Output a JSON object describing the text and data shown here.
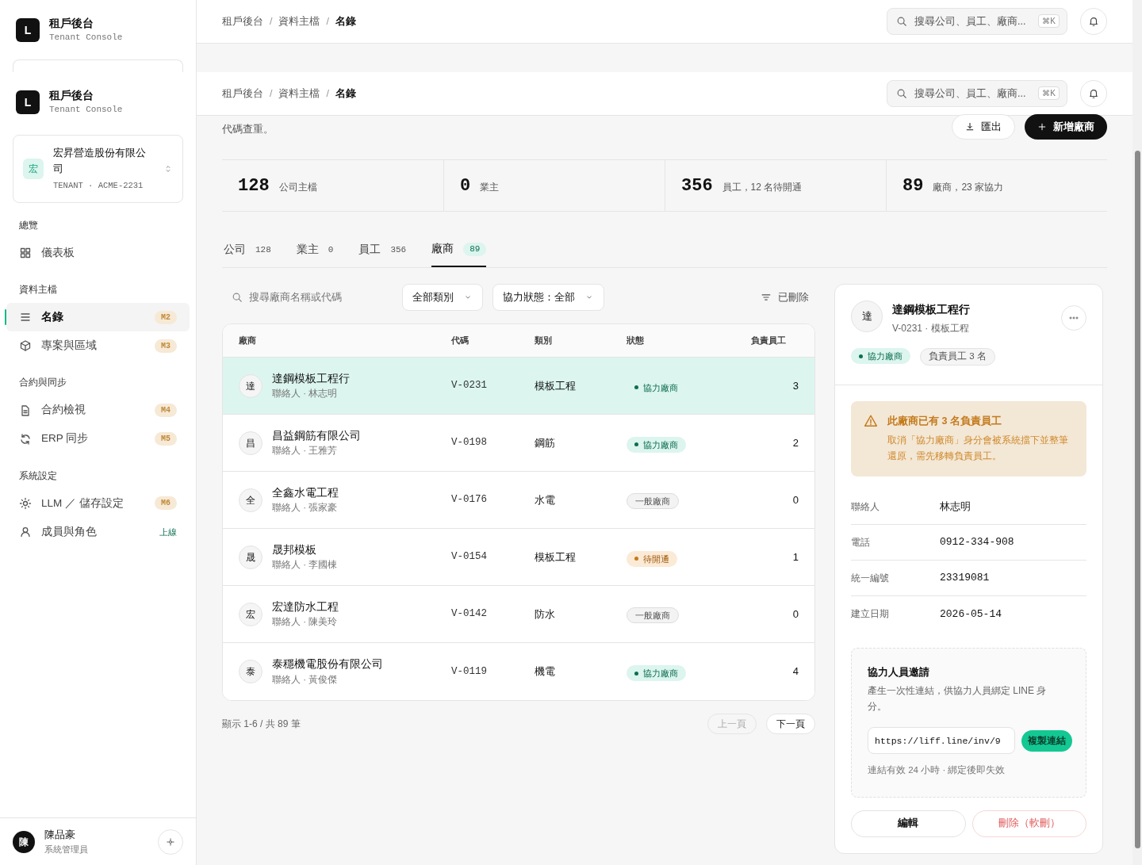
{
  "sidebar": {
    "brands": [
      {
        "logo": "L",
        "title": "租戶後台",
        "subtitle": "Tenant Console"
      },
      {
        "logo": "L",
        "title": "租戶後台",
        "subtitle": "Tenant Console"
      }
    ],
    "tenant": {
      "avatar": "宏",
      "name": "宏昇營造股份有限公司",
      "meta": "TENANT · ACME-2231"
    },
    "sections": [
      {
        "title": "總覽",
        "items": [
          {
            "label": "儀表板",
            "selected": false
          }
        ]
      },
      {
        "title": "資料主檔",
        "items": [
          {
            "label": "名錄",
            "selected": true,
            "badge": "M2",
            "kind": "milestone"
          },
          {
            "label": "專案與區域",
            "selected": false,
            "badge": "M3",
            "kind": "milestone"
          }
        ]
      },
      {
        "title": "合約與同步",
        "items": [
          {
            "label": "合約檢視",
            "selected": false,
            "badge": "M4",
            "kind": "milestone"
          },
          {
            "label": "ERP 同步",
            "selected": false,
            "badge": "M5",
            "kind": "milestone"
          }
        ]
      },
      {
        "title": "系統設定",
        "items": [
          {
            "label": "LLM ／ 儲存設定",
            "selected": false,
            "badge": "M6",
            "kind": "milestone"
          },
          {
            "label": "成員與角色",
            "selected": false,
            "badge": "上線",
            "kind": "live"
          }
        ]
      }
    ],
    "user": {
      "avatar": "陳",
      "name": "陳品豪",
      "role": "系統管理員"
    }
  },
  "headers": [
    {
      "breadcrumbs": [
        "租戶後台",
        "資料主檔",
        "名錄"
      ],
      "separator": "/",
      "search_placeholder": "搜尋公司、員工、廠商...",
      "shortcut": "⌘K"
    },
    {
      "breadcrumbs": [
        "租戶後台",
        "資料主檔",
        "名錄"
      ],
      "separator": "/",
      "search_placeholder": "搜尋公司、員工、廠商...",
      "shortcut": "⌘K"
    }
  ],
  "description": "代碼查重。",
  "actions": [
    {
      "label": "匯出",
      "kind": "secondary"
    },
    {
      "label": "新增廠商",
      "kind": "primary"
    }
  ],
  "stats": [
    {
      "value": "128",
      "label": "公司主檔"
    },
    {
      "value": "0",
      "label": "業主"
    },
    {
      "value": "356",
      "label": "員工，12 名待開通"
    },
    {
      "value": "89",
      "label": "廠商，23 家協力"
    }
  ],
  "tabs": [
    {
      "label": "公司",
      "count": "128",
      "selected": false
    },
    {
      "label": "業主",
      "count": "0",
      "selected": false
    },
    {
      "label": "員工",
      "count": "356",
      "selected": false
    },
    {
      "label": "廠商",
      "count": "89",
      "selected": true
    }
  ],
  "filters": {
    "search_placeholder": "搜尋廠商名稱或代碼",
    "dropdowns": [
      "全部類別",
      "協力狀態：全部"
    ],
    "deleted_toggle": "已刪除"
  },
  "table": {
    "columns": [
      "廠商",
      "代碼",
      "類別",
      "狀態",
      "負責員工"
    ],
    "rows": [
      {
        "avatar": "達",
        "name": "達鋼模板工程行",
        "contact": "聯絡人 · 林志明",
        "code": "V-0231",
        "category": "模板工程",
        "status": {
          "label": "協力廠商",
          "kind": "partner"
        },
        "staff": "3",
        "selected": true
      },
      {
        "avatar": "昌",
        "name": "昌益鋼筋有限公司",
        "contact": "聯絡人 · 王雅芳",
        "code": "V-0198",
        "category": "鋼筋",
        "status": {
          "label": "協力廠商",
          "kind": "partner"
        },
        "staff": "2",
        "selected": false
      },
      {
        "avatar": "全",
        "name": "全鑫水電工程",
        "contact": "聯絡人 · 張家豪",
        "code": "V-0176",
        "category": "水電",
        "status": {
          "label": "一般廠商",
          "kind": "normal"
        },
        "staff": "0",
        "selected": false
      },
      {
        "avatar": "晟",
        "name": "晟邦模板",
        "contact": "聯絡人 · 李國棟",
        "code": "V-0154",
        "category": "模板工程",
        "status": {
          "label": "待開通",
          "kind": "pending"
        },
        "staff": "1",
        "selected": false
      },
      {
        "avatar": "宏",
        "name": "宏達防水工程",
        "contact": "聯絡人 · 陳美玲",
        "code": "V-0142",
        "category": "防水",
        "status": {
          "label": "一般廠商",
          "kind": "normal"
        },
        "staff": "0",
        "selected": false
      },
      {
        "avatar": "泰",
        "name": "泰穩機電股份有限公司",
        "contact": "聯絡人 · 黃俊傑",
        "code": "V-0119",
        "category": "機電",
        "status": {
          "label": "協力廠商",
          "kind": "partner"
        },
        "staff": "4",
        "selected": false
      }
    ]
  },
  "pagination": {
    "summary": "顯示 1-6 / 共 89 筆",
    "buttons": [
      {
        "label": "上一頁",
        "disabled": true
      },
      {
        "label": "下一頁",
        "disabled": false
      }
    ]
  },
  "detail": {
    "avatar": "達",
    "name": "達鋼模板工程行",
    "subtitle": "V-0231 · 模板工程",
    "tags": [
      {
        "label": "協力廠商",
        "kind": "partner"
      },
      {
        "label": "負責員工 3 名",
        "kind": "plain"
      }
    ],
    "warning": {
      "title": "此廠商已有 3 名負責員工",
      "body": "取消「協力廠商」身分會被系統擋下並整筆還原，需先移轉負責員工。"
    },
    "fields": [
      {
        "label": "聯絡人",
        "value": "林志明"
      },
      {
        "label": "電話",
        "value": "0912-334-908"
      },
      {
        "label": "統一編號",
        "value": "23319081"
      },
      {
        "label": "建立日期",
        "value": "2026-05-14"
      }
    ],
    "invite": {
      "title": "協力人員邀請",
      "description": "產生一次性連結，供協力人員綁定 LINE 身分。",
      "link": "https://liff.line/inv/9",
      "copy_label": "複製連結",
      "note": "連結有效 24 小時 · 綁定後即失效"
    },
    "buttons": [
      {
        "label": "編輯",
        "kind": "default"
      },
      {
        "label": "刪除（軟刪）",
        "kind": "danger"
      }
    ]
  }
}
